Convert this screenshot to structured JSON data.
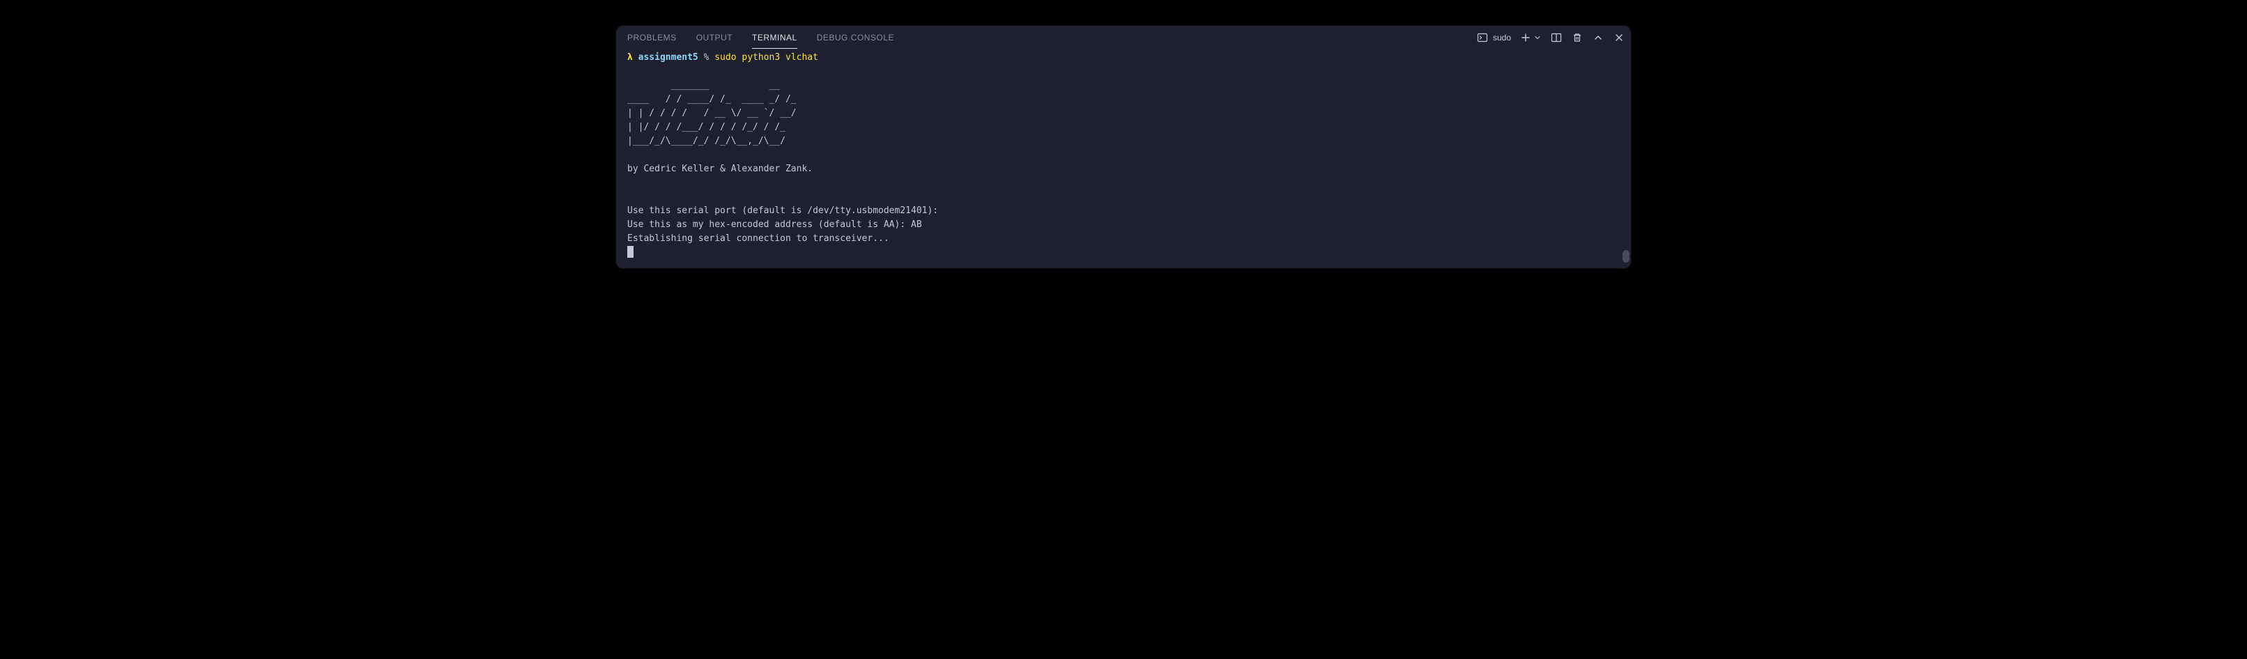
{
  "tabs": {
    "problems": "PROBLEMS",
    "output": "OUTPUT",
    "terminal": "TERMINAL",
    "debug_console": "DEBUG CONSOLE"
  },
  "toolbar": {
    "terminal_name": "sudo"
  },
  "prompt": {
    "symbol": "λ",
    "directory": "assignment5",
    "separator": "%",
    "command": "sudo python3 vlchat"
  },
  "output": {
    "ascii_art": "        _______           __ \n____   / / ____/ /_  ____ _/ /_\n| | / / / /   / __ \\/ __ `/ __/\n| |/ / / /___/ / / / /_/ / /_ \n|___/_/\\____/_/ /_/\\__,_/\\__/",
    "byline": "by Cedric Keller & Alexander Zank.",
    "prompt_serial": "Use this serial port (default is /dev/tty.usbmodem21401): ",
    "prompt_address": "Use this as my hex-encoded address (default is AA): AB",
    "establishing": "Establishing serial connection to transceiver..."
  }
}
